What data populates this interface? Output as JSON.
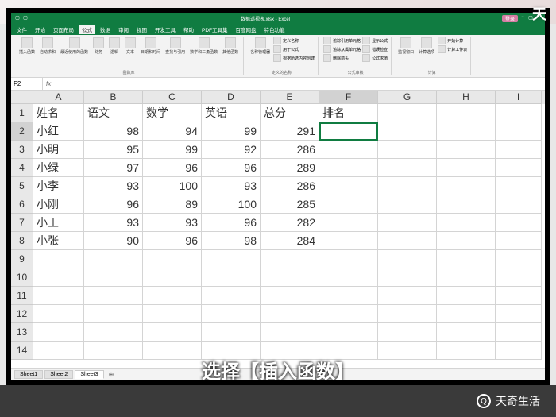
{
  "topRightLogo": "天",
  "titlebar": {
    "docName": "数据透视表.xlsx - Excel",
    "loginPill": "登录"
  },
  "menubar": {
    "items": [
      "文件",
      "开始",
      "页面布局",
      "公式",
      "数据",
      "审阅",
      "视图",
      "开发工具",
      "帮助",
      "PDF工具集",
      "百度网盘",
      "特色功能"
    ]
  },
  "ribbon": {
    "groups": [
      {
        "label": "函数库",
        "buttons": [
          "插入函数",
          "自动求和",
          "最近使用的函数",
          "财务",
          "逻辑",
          "文本",
          "日期和时间",
          "查找与引用",
          "数学和三角函数",
          "其他函数"
        ]
      },
      {
        "label": "定义的名称",
        "buttons": [
          "名称管理器"
        ],
        "small": [
          "定义名称",
          "用于公式",
          "根据所选内容创建"
        ]
      },
      {
        "label": "公式审核",
        "small": [
          "追踪引用单元格",
          "追踪从属单元格",
          "删除箭头",
          "显示公式",
          "错误检查",
          "公式求值"
        ]
      },
      {
        "label": "计算",
        "buttons": [
          "监视窗口",
          "计算选项"
        ],
        "small": [
          "开始计算",
          "计算工作表"
        ]
      }
    ]
  },
  "formulaBar": {
    "nameBox": "F2",
    "fx": "fx",
    "value": ""
  },
  "columns": [
    "A",
    "B",
    "C",
    "D",
    "E",
    "F",
    "G",
    "H",
    "I"
  ],
  "headerRow": [
    "姓名",
    "语文",
    "数学",
    "英语",
    "总分",
    "排名"
  ],
  "dataRows": [
    {
      "name": "小红",
      "chinese": 98,
      "math": 94,
      "english": 99,
      "total": 291
    },
    {
      "name": "小明",
      "chinese": 95,
      "math": 99,
      "english": 92,
      "total": 286
    },
    {
      "name": "小绿",
      "chinese": 97,
      "math": 96,
      "english": 96,
      "total": 289
    },
    {
      "name": "小李",
      "chinese": 93,
      "math": 100,
      "english": 93,
      "total": 286
    },
    {
      "name": "小刚",
      "chinese": 96,
      "math": 89,
      "english": 100,
      "total": 285
    },
    {
      "name": "小王",
      "chinese": 93,
      "math": 93,
      "english": 96,
      "total": 282
    },
    {
      "name": "小张",
      "chinese": 90,
      "math": 96,
      "english": 98,
      "total": 284
    }
  ],
  "selectedCell": "F2",
  "emptyRowsAfter": 7,
  "sheetTabs": [
    "Sheet1",
    "Sheet2",
    "Sheet3"
  ],
  "activeSheet": "Sheet3",
  "subtitle": "选择【插入函数】",
  "bottomLogo": "天奇生活"
}
